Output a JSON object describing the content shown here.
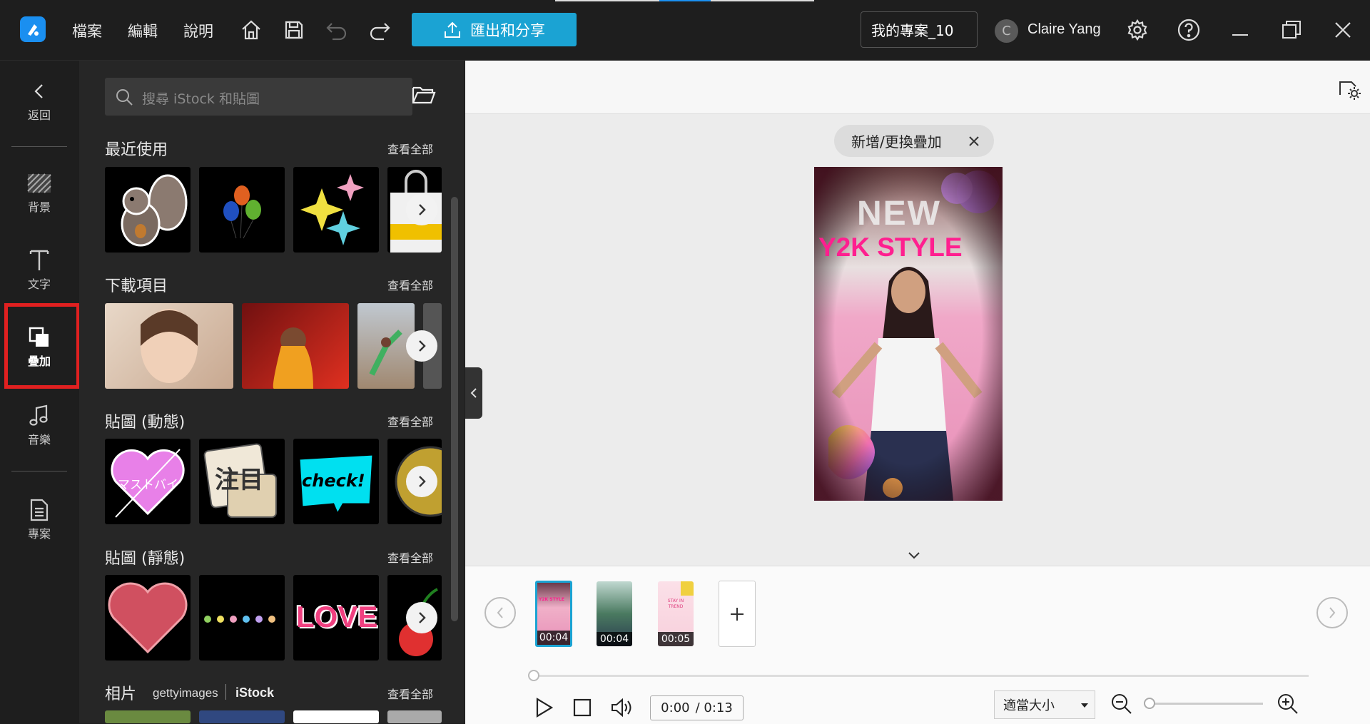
{
  "menu": {
    "file": "檔案",
    "edit": "編輯",
    "help": "說明"
  },
  "export_button": "匯出和分享",
  "project_name": "我的專案_10",
  "user": {
    "initial": "C",
    "name": "Claire Yang"
  },
  "leftnav": {
    "back": "返回",
    "background": "背景",
    "text": "文字",
    "overlay": "疊加",
    "music": "音樂",
    "project": "專案"
  },
  "library": {
    "search_placeholder": "搜尋 iStock 和貼圖",
    "see_all": "查看全部",
    "sections": {
      "recent": "最近使用",
      "downloads": "下載項目",
      "stickers_animated": "貼圖 (動態)",
      "stickers_static": "貼圖 (靜態)",
      "photos": "相片"
    },
    "photos_brand_getty": "gettyimages",
    "photos_brand_istock": "iStock",
    "sticker_check": "check!",
    "sticker_love": "LOVE",
    "sticker_heart_text": "マストバイ",
    "sticker_notice": "注目"
  },
  "preview": {
    "overlay_chip": "新增/更換疊加",
    "video_text_new": "NEW",
    "video_text_style": "Y2K STYLE"
  },
  "timeline": {
    "clips": [
      {
        "duration": "00:04",
        "label": "Y2K STYLE"
      },
      {
        "duration": "00:04",
        "label": ""
      },
      {
        "duration": "00:05",
        "label": "STAY IN TREND"
      }
    ],
    "time_current": "0:00",
    "time_total": "/ 0:13",
    "fit_option": "適當大小"
  },
  "colors": {
    "accent": "#1ba3d3",
    "active_highlight": "#e02020",
    "video_pink": "#ff1f8f"
  }
}
